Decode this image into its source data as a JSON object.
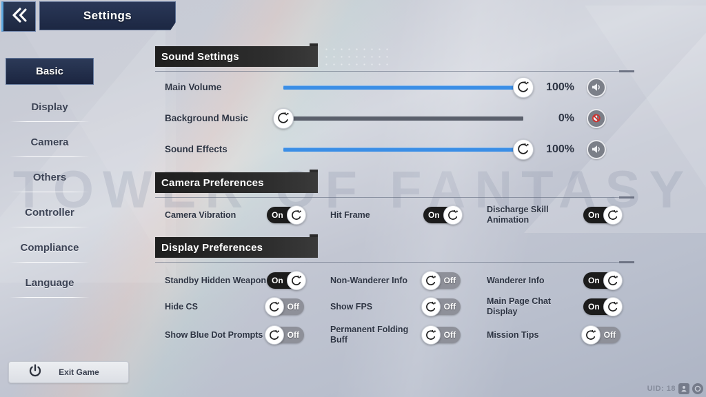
{
  "window": {
    "title": "Settings",
    "back_icon": "double-chevron-left-icon",
    "watermark": "TOWER OF FANTASY"
  },
  "sidebar": {
    "items": [
      {
        "label": "Basic",
        "active": true
      },
      {
        "label": "Display",
        "active": false
      },
      {
        "label": "Camera",
        "active": false
      },
      {
        "label": "Others",
        "active": false
      },
      {
        "label": "Controller",
        "active": false
      },
      {
        "label": "Compliance",
        "active": false
      },
      {
        "label": "Language",
        "active": false
      }
    ],
    "exit": {
      "label": "Exit Game",
      "icon": "power-icon"
    }
  },
  "sections": {
    "sound": {
      "title": "Sound Settings",
      "sliders": [
        {
          "label": "Main Volume",
          "value": 100,
          "value_text": "100%",
          "fill": true,
          "icon": "speaker-on-icon"
        },
        {
          "label": "Background Music",
          "value": 0,
          "value_text": "0%",
          "fill": false,
          "icon": "speaker-mute-icon"
        },
        {
          "label": "Sound Effects",
          "value": 100,
          "value_text": "100%",
          "fill": true,
          "icon": "speaker-on-icon"
        }
      ]
    },
    "camera": {
      "title": "Camera Preferences",
      "toggles": [
        {
          "label": "Camera Vibration",
          "state": "On",
          "on": true
        },
        {
          "label": "Hit Frame",
          "state": "On",
          "on": true
        },
        {
          "label": "Discharge Skill Animation",
          "state": "On",
          "on": true
        }
      ]
    },
    "display": {
      "title": "Display Preferences",
      "toggles": [
        {
          "label": "Standby Hidden Weapon",
          "state": "On",
          "on": true
        },
        {
          "label": "Non-Wanderer Info",
          "state": "Off",
          "on": false
        },
        {
          "label": "Wanderer Info",
          "state": "On",
          "on": true
        },
        {
          "label": "Hide CS",
          "state": "Off",
          "on": false
        },
        {
          "label": "Show FPS",
          "state": "Off",
          "on": false
        },
        {
          "label": "Main Page Chat Display",
          "state": "On",
          "on": true
        },
        {
          "label": "Show Blue Dot Prompts",
          "state": "Off",
          "on": false
        },
        {
          "label": "Permanent Folding Buff",
          "state": "Off",
          "on": false
        },
        {
          "label": "Mission Tips",
          "state": "Off",
          "on": false
        }
      ]
    }
  },
  "footer": {
    "uid_text": "UID: 18",
    "icons": [
      "person-icon",
      "circle-icon"
    ]
  },
  "colors": {
    "slider_fill": "#3a8ee6",
    "slider_empty": "#5a5f6b",
    "toggle_on": "#1c1c1c",
    "toggle_off": "#8e9099",
    "header_bar": "#2b2b2b",
    "active_nav": "#223052"
  }
}
